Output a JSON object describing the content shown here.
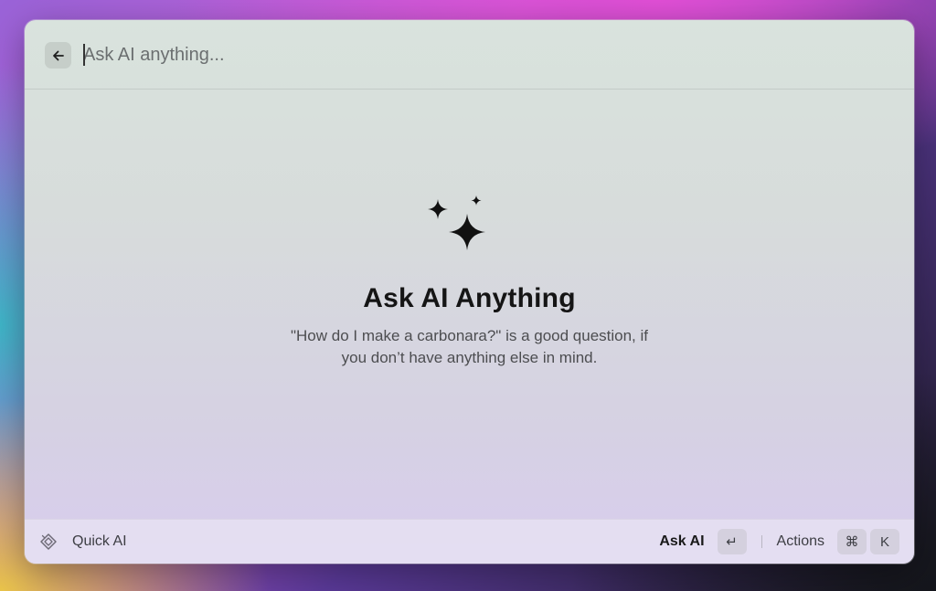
{
  "search": {
    "placeholder": "Ask AI anything...",
    "value": ""
  },
  "empty_state": {
    "icon": "sparkles-icon",
    "title": "Ask AI Anything",
    "description": "\"How do I make a carbonara?\" is a good question, if you don’t have anything else in mind."
  },
  "footer": {
    "command_icon": "quick-ai-icon",
    "command_label": "Quick AI",
    "primary_action_label": "Ask AI",
    "primary_action_key": "↵",
    "actions_label": "Actions",
    "actions_keys": [
      "⌘",
      "K"
    ]
  },
  "icons": {
    "back": "arrow-left-icon"
  }
}
